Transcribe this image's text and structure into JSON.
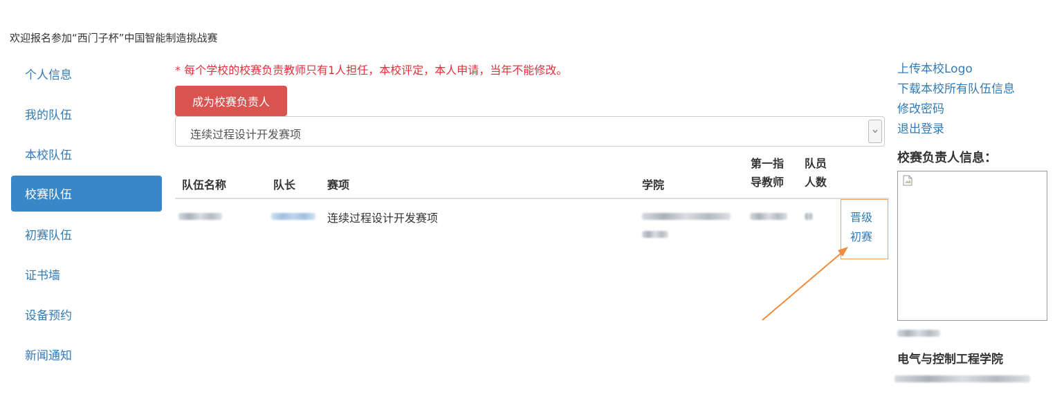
{
  "welcome_text": "欢迎报名参加“西门子杯”中国智能制造挑战赛",
  "sidebar": {
    "items": [
      {
        "label": "个人信息"
      },
      {
        "label": "我的队伍"
      },
      {
        "label": "本校队伍"
      },
      {
        "label": "校赛队伍",
        "active": true
      },
      {
        "label": "初赛队伍"
      },
      {
        "label": "证书墙"
      },
      {
        "label": "设备预约"
      },
      {
        "label": "新闻通知"
      }
    ]
  },
  "main": {
    "notice": "* 每个学校的校赛负责教师只有1人担任，本校评定，本人申请，当年不能修改。",
    "become_leader_button": "成为校赛负责人",
    "event_select": {
      "value": "连续过程设计开发赛项"
    },
    "table": {
      "headers": {
        "team_name": "队伍名称",
        "captain": "队长",
        "event": "赛项",
        "college": "学院",
        "advisor_line1": "第一指",
        "advisor_line2": "导教师",
        "members_line1": "队员",
        "members_line2": "人数"
      },
      "rows": [
        {
          "event": "连续过程设计开发赛项",
          "action_line1": "晋级",
          "action_line2": "初赛"
        }
      ]
    }
  },
  "right_panel": {
    "links": [
      "上传本校Logo",
      "下载本校所有队伍信息",
      "修改密码",
      "退出登录"
    ],
    "leader_info_heading": "校赛负责人信息：",
    "leader_college": "电气与控制工程学院"
  },
  "colors": {
    "link": "#337ab7",
    "active_nav": "#3a87c8",
    "danger_button": "#d9534f",
    "notice_text": "#e0303a",
    "highlight_box": "#f0a160",
    "annotation_arrow": "#f28a3a"
  },
  "icons": {
    "select_caret": "chevron-down-icon",
    "logo_placeholder": "broken-image-icon",
    "annotation": "arrow-icon"
  }
}
